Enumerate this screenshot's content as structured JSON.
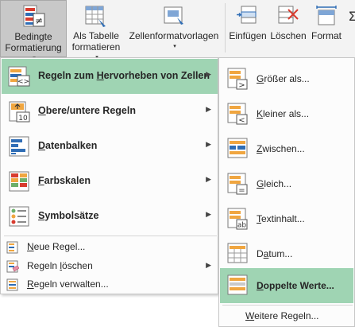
{
  "ribbon": {
    "conditional_formatting": {
      "line1": "Bedingte",
      "line2": "Formatierung",
      "caret": "▾",
      "icon": "conditional-formatting-icon"
    },
    "format_as_table": {
      "line1": "Als Tabelle",
      "line2": "formatieren",
      "caret": "▾",
      "icon": "table-format-icon"
    },
    "cell_styles": {
      "line1": "Zellenformatvorlagen",
      "caret": "▾",
      "icon": "cell-styles-icon"
    },
    "insert": {
      "line1": "Einfügen",
      "icon": "insert-cells-icon"
    },
    "delete": {
      "line1": "Löschen",
      "icon": "delete-cells-icon"
    },
    "format": {
      "line1": "Format",
      "icon": "format-cells-icon"
    }
  },
  "menu": {
    "items": [
      {
        "label_pre": "Regeln zum ",
        "label_key": "H",
        "label_post": "ervorheben von Zellen",
        "icon": "highlight-rules-icon",
        "has_submenu": true,
        "highlighted": true
      },
      {
        "label_pre": "",
        "label_key": "O",
        "label_post": "bere/untere Regeln",
        "icon": "top-bottom-rules-icon",
        "has_submenu": true
      },
      {
        "label_pre": "",
        "label_key": "D",
        "label_post": "atenbalken",
        "icon": "data-bars-icon",
        "has_submenu": true
      },
      {
        "label_pre": "",
        "label_key": "F",
        "label_post": "arbskalen",
        "icon": "color-scales-icon",
        "has_submenu": true
      },
      {
        "label_pre": "",
        "label_key": "S",
        "label_post": "ymbolsätze",
        "icon": "icon-sets-icon",
        "has_submenu": true
      }
    ],
    "small_items": [
      {
        "label_pre": "",
        "label_key": "N",
        "label_post": "eue Regel...",
        "icon": "new-rule-icon",
        "has_submenu": false
      },
      {
        "label_pre": "Regeln ",
        "label_key": "l",
        "label_post": "öschen",
        "icon": "clear-rules-icon",
        "has_submenu": true
      },
      {
        "label_pre": "",
        "label_key": "R",
        "label_post": "egeln verwalten...",
        "icon": "manage-rules-icon",
        "has_submenu": false
      }
    ],
    "arrow": "▶"
  },
  "submenu": {
    "items": [
      {
        "label_pre": "",
        "label_key": "G",
        "label_post": "rößer als...",
        "icon": "greater-than-icon"
      },
      {
        "label_pre": "",
        "label_key": "K",
        "label_post": "leiner als...",
        "icon": "less-than-icon"
      },
      {
        "label_pre": "",
        "label_key": "Z",
        "label_post": "wischen...",
        "icon": "between-icon"
      },
      {
        "label_pre": "",
        "label_key": "G",
        "label_post": "leich...",
        "icon": "equal-to-icon"
      },
      {
        "label_pre": "",
        "label_key": "T",
        "label_post": "extinhalt...",
        "icon": "text-contains-icon"
      },
      {
        "label_pre": "D",
        "label_key": "a",
        "label_post": "tum...",
        "icon": "date-occurring-icon"
      },
      {
        "label_pre": "",
        "label_key": "D",
        "label_post": "oppelte Werte...",
        "icon": "duplicate-values-icon",
        "highlighted": true
      }
    ],
    "more": {
      "label_pre": "",
      "label_key": "W",
      "label_post": "eitere Regeln..."
    }
  },
  "colors": {
    "highlight": "#9fd4b3",
    "accent_red": "#d83b2e",
    "accent_blue": "#2f6db5",
    "accent_orange": "#f0a640"
  }
}
